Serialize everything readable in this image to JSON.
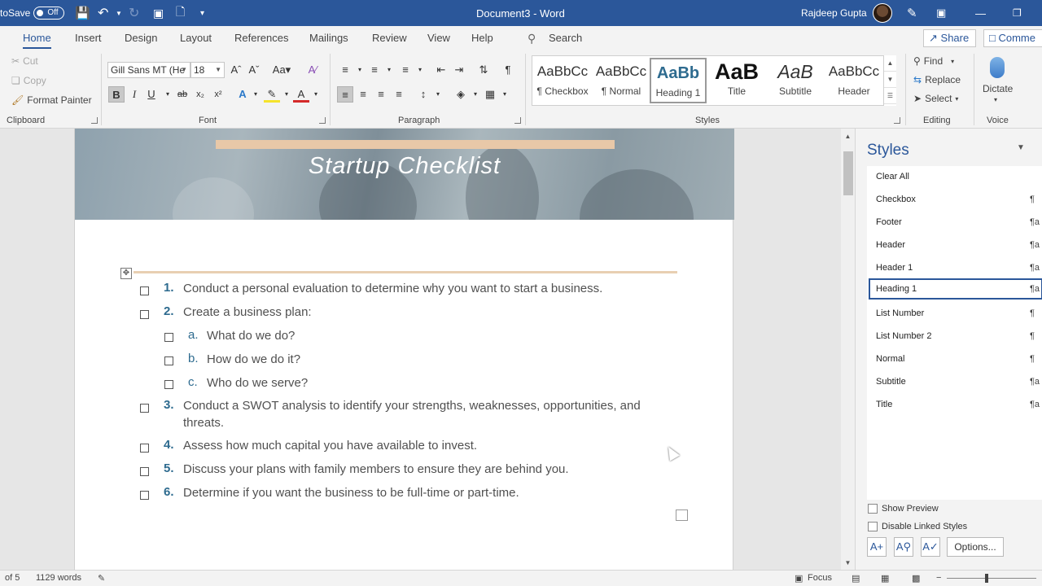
{
  "titlebar": {
    "autosave_label": "toSave",
    "autosave_state": "Off",
    "document_title": "Document3  -  Word",
    "user_name": "Rajdeep Gupta"
  },
  "tabs": {
    "items": [
      "Home",
      "Insert",
      "Design",
      "Layout",
      "References",
      "Mailings",
      "Review",
      "View",
      "Help"
    ],
    "search": "Search",
    "share": "Share",
    "comments": "Comme"
  },
  "ribbon": {
    "clipboard": {
      "cut": "Cut",
      "copy": "Copy",
      "format_painter": "Format Painter",
      "label": "Clipboard"
    },
    "font": {
      "name": "Gill Sans MT (He",
      "size": "18",
      "label": "Font"
    },
    "paragraph": {
      "label": "Paragraph"
    },
    "styles": {
      "label": "Styles",
      "gallery": [
        {
          "sample": "AaBbCc",
          "name": "¶ Checkbox"
        },
        {
          "sample": "AaBbCc",
          "name": "¶ Normal"
        },
        {
          "sample": "AaBb",
          "name": "Heading 1"
        },
        {
          "sample": "AaB",
          "name": "Title"
        },
        {
          "sample": "AaB",
          "name": "Subtitle"
        },
        {
          "sample": "AaBbCc",
          "name": "Header"
        }
      ]
    },
    "editing": {
      "find": "Find",
      "replace": "Replace",
      "select": "Select",
      "label": "Editing"
    },
    "voice": {
      "dictate": "Dictate",
      "label": "Voice"
    }
  },
  "document": {
    "banner_title": "Startup Checklist",
    "items": [
      {
        "num": "1.",
        "text": "Conduct a personal evaluation to determine why you want to start a business."
      },
      {
        "num": "2.",
        "text": "Create a business plan:"
      },
      {
        "num": "a.",
        "text": "What do we do?"
      },
      {
        "num": "b.",
        "text": "How do we do it?"
      },
      {
        "num": "c.",
        "text": "Who do we serve?"
      },
      {
        "num": "3.",
        "text": "Conduct a SWOT analysis to identify your strengths, weaknesses, opportunities, and threats."
      },
      {
        "num": "4.",
        "text": "Assess how much capital you have available to invest."
      },
      {
        "num": "5.",
        "text": "Discuss your plans with family members to ensure they are behind you."
      },
      {
        "num": "6.",
        "text": "Determine if you want the business to be full-time or part-time."
      }
    ]
  },
  "styles_pane": {
    "title": "Styles",
    "styles": [
      {
        "name": "Clear All",
        "glyph": ""
      },
      {
        "name": "Checkbox",
        "glyph": "¶"
      },
      {
        "name": "Footer",
        "glyph": "¶a"
      },
      {
        "name": "Header",
        "glyph": "¶a"
      },
      {
        "name": "Header 1",
        "glyph": "¶a"
      },
      {
        "name": "Heading 1",
        "glyph": "¶a"
      },
      {
        "name": "List Number",
        "glyph": "¶"
      },
      {
        "name": "List Number 2",
        "glyph": "¶"
      },
      {
        "name": "Normal",
        "glyph": "¶"
      },
      {
        "name": "Subtitle",
        "glyph": "¶a"
      },
      {
        "name": "Title",
        "glyph": "¶a"
      }
    ],
    "show_preview": "Show Preview",
    "disable_linked": "Disable Linked Styles",
    "options": "Options..."
  },
  "statusbar": {
    "page": "of 5",
    "words": "1129 words",
    "focus": "Focus"
  },
  "colors": {
    "accent": "#2b579a",
    "list_number": "#2e6b8f",
    "banner_bar": "#e8c8a8"
  }
}
